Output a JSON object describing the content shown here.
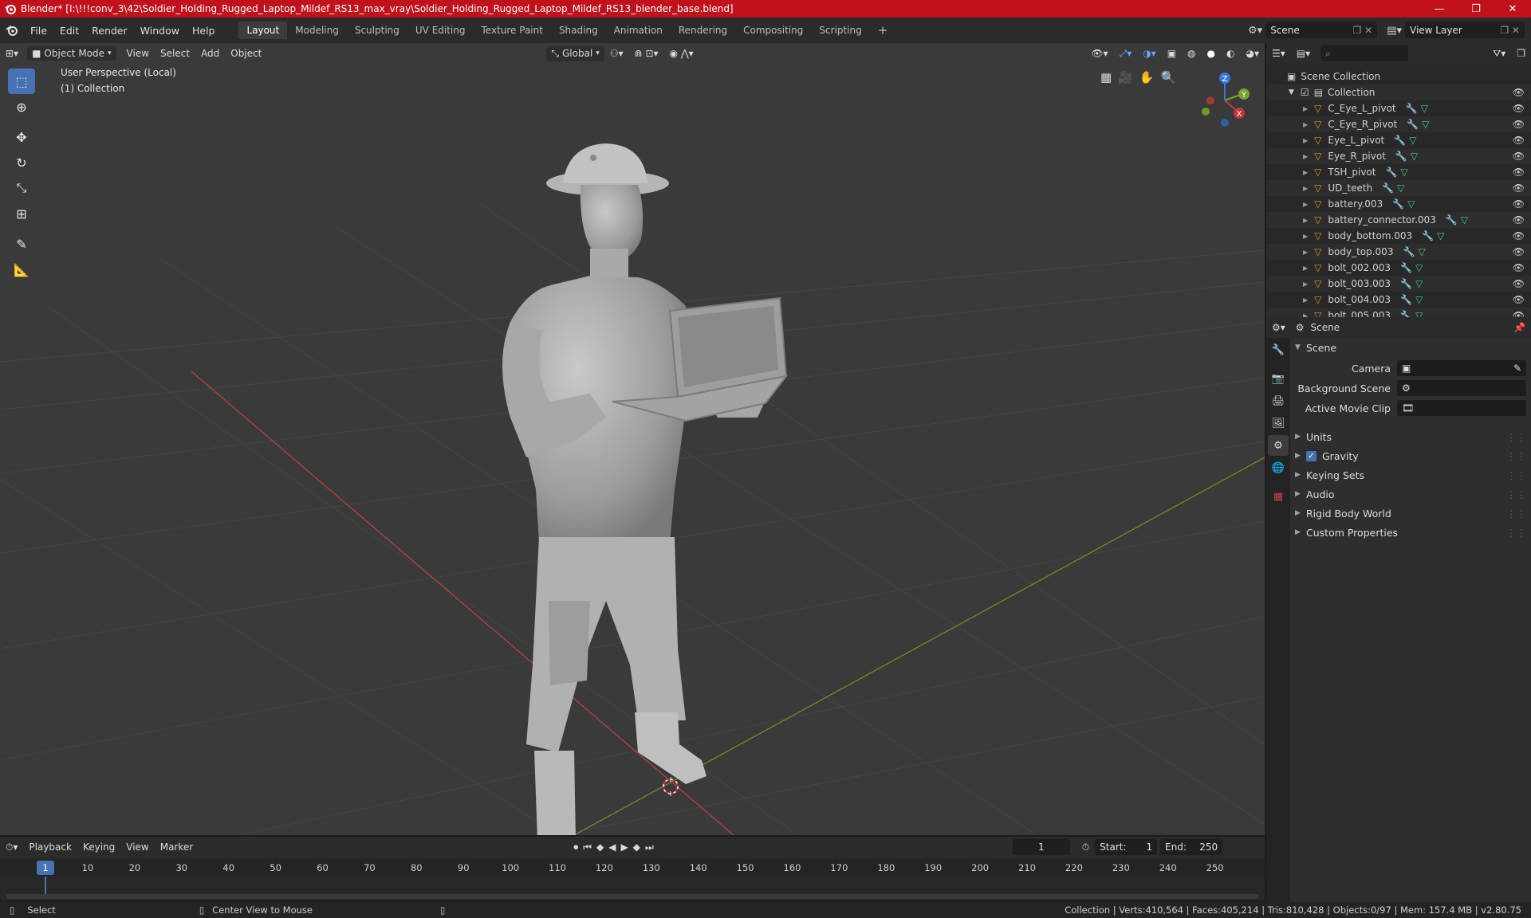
{
  "window": {
    "title": "Blender* [I:\\!!!conv_3\\42\\Soldier_Holding_Rugged_Laptop_Mildef_RS13_max_vray\\Soldier_Holding_Rugged_Laptop_Mildef_RS13_blender_base.blend]",
    "minimize": "—",
    "maximize": "❐",
    "close": "✕"
  },
  "menubar": {
    "menus": [
      "File",
      "Edit",
      "Render",
      "Window",
      "Help"
    ],
    "workspaces": [
      "Layout",
      "Modeling",
      "Sculpting",
      "UV Editing",
      "Texture Paint",
      "Shading",
      "Animation",
      "Rendering",
      "Compositing",
      "Scripting"
    ],
    "active_workspace": "Layout",
    "add_workspace": "+",
    "scene_name": "Scene",
    "view_layer": "View Layer"
  },
  "viewport": {
    "mode": "Object Mode",
    "menus": [
      "View",
      "Select",
      "Add",
      "Object"
    ],
    "transform_orientation": "Global",
    "overlay_line1": "User Perspective (Local)",
    "overlay_line2": "(1) Collection",
    "gizmo": {
      "x": "X",
      "y": "Y",
      "z": "Z"
    }
  },
  "outliner": {
    "root": "Scene Collection",
    "collection": "Collection",
    "objects": [
      "C_Eye_L_pivot",
      "C_Eye_R_pivot",
      "Eye_L_pivot",
      "Eye_R_pivot",
      "TSH_pivot",
      "UD_teeth",
      "battery.003",
      "battery_connector.003",
      "body_bottom.003",
      "body_top.003",
      "bolt_002.003",
      "bolt_003.003",
      "bolt_004.003",
      "bolt_005.003"
    ]
  },
  "properties": {
    "context": "Scene",
    "panel_title": "Scene",
    "fields": [
      {
        "label": "Camera",
        "value": ""
      },
      {
        "label": "Background Scene",
        "value": ""
      },
      {
        "label": "Active Movie Clip",
        "value": ""
      }
    ],
    "sections": [
      "Units",
      "Gravity",
      "Keying Sets",
      "Audio",
      "Rigid Body World",
      "Custom Properties"
    ],
    "gravity_checked": true
  },
  "timeline": {
    "menus": [
      "Playback",
      "Keying",
      "View",
      "Marker"
    ],
    "current_frame": "1",
    "start_label": "Start:",
    "start": "1",
    "end_label": "End:",
    "end": "250",
    "ruler": [
      "10",
      "20",
      "30",
      "40",
      "50",
      "60",
      "70",
      "80",
      "90",
      "100",
      "110",
      "120",
      "130",
      "140",
      "150",
      "160",
      "170",
      "180",
      "190",
      "200",
      "210",
      "220",
      "230",
      "240",
      "250"
    ],
    "playhead": "1"
  },
  "statusbar": {
    "left_action": "Select",
    "middle_action": "Center View to Mouse",
    "stats": "Collection | Verts:410,564 | Faces:405,214 | Tris:810,428 | Objects:0/97 | Mem: 157.4 MB | v2.80.75"
  },
  "colors": {
    "titlebar": "#c1121c",
    "accent": "#4772b3",
    "x_axis": "#c0393b",
    "y_axis": "#7aa32b",
    "z_axis": "#3b77d8"
  }
}
